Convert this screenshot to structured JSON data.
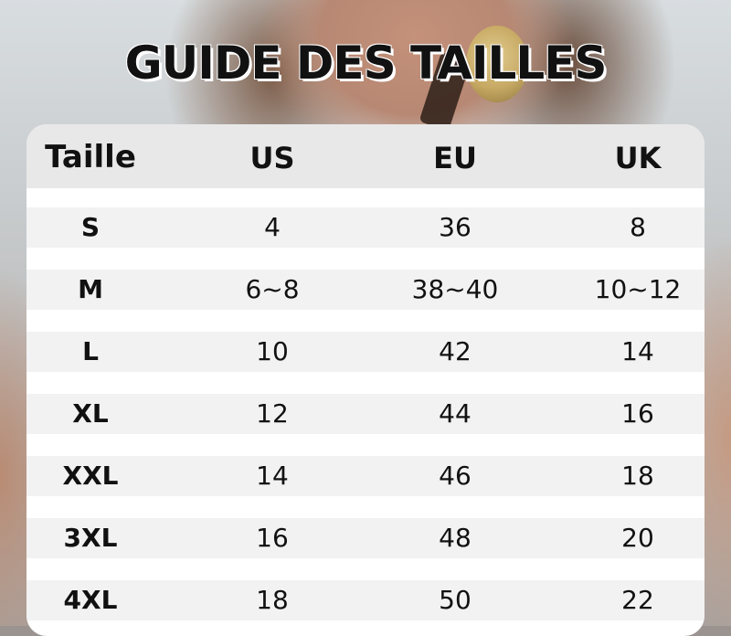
{
  "title": "GUIDE DES TAILLES",
  "table": {
    "headers": [
      "Taille",
      "US",
      "EU",
      "UK"
    ],
    "rows": [
      [
        "S",
        "4",
        "36",
        "8"
      ],
      [
        "M",
        "6~8",
        "38~40",
        "10~12"
      ],
      [
        "L",
        "10",
        "42",
        "14"
      ],
      [
        "XL",
        "12",
        "44",
        "16"
      ],
      [
        "XXL",
        "14",
        "46",
        "18"
      ],
      [
        "3XL",
        "16",
        "48",
        "20"
      ],
      [
        "4XL",
        "18",
        "50",
        "22"
      ]
    ]
  }
}
